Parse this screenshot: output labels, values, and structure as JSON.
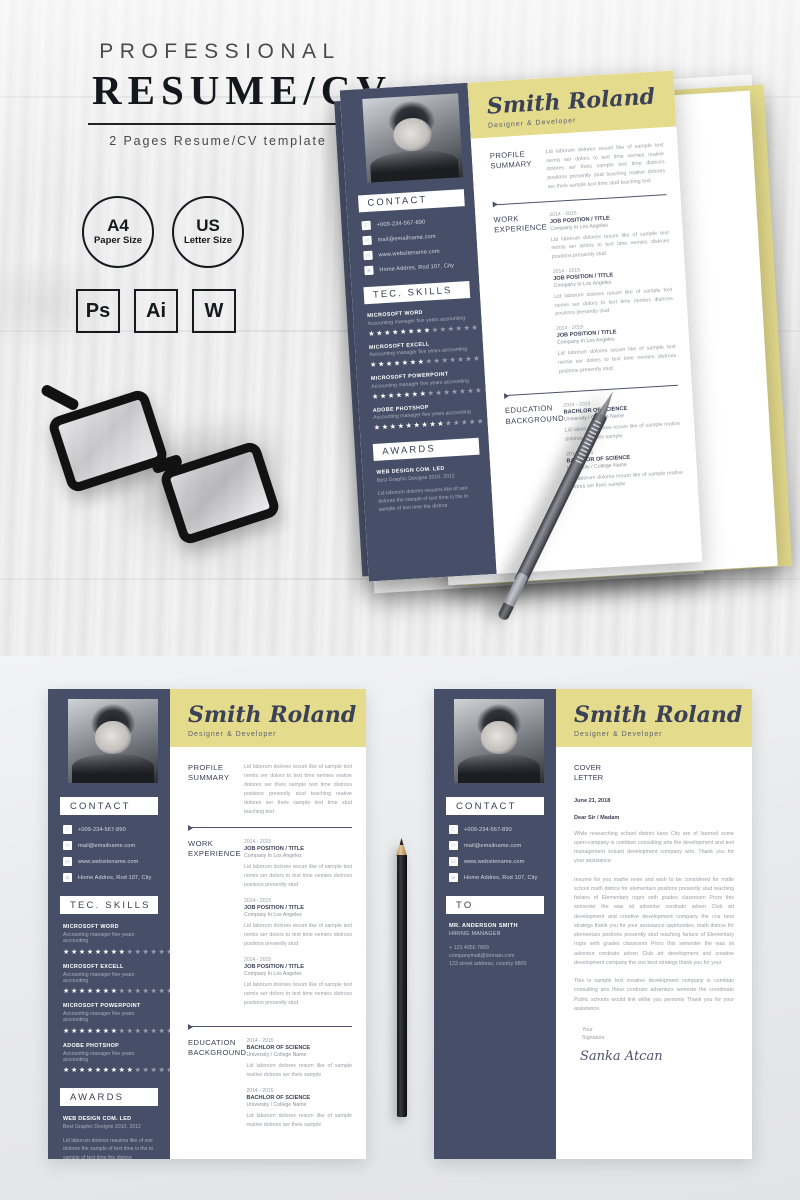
{
  "header": {
    "kicker": "PROFESSIONAL",
    "title": "RESUME/CV",
    "subtitle": "2 Pages Resume/CV template"
  },
  "badges": [
    {
      "big": "A4",
      "small": "Paper Size"
    },
    {
      "big": "US",
      "small": "Letter Size"
    }
  ],
  "formats": [
    {
      "label": "Ps"
    },
    {
      "label": "Ai"
    },
    {
      "label": "W"
    }
  ],
  "resume": {
    "name": "Smith Roland",
    "role": "Designer & Developer",
    "contact_heading": "CONTACT",
    "contact": [
      {
        "icon": "phone-icon",
        "glyph": "✆",
        "text": "+009-234-567-890"
      },
      {
        "icon": "mail-icon",
        "glyph": "✉",
        "text": "mail@emailname.com"
      },
      {
        "icon": "globe-icon",
        "glyph": "▤",
        "text": "www.websitename.com"
      },
      {
        "icon": "location-icon",
        "glyph": "◉",
        "text": "Home Addres, Rod 107, City"
      }
    ],
    "skills_heading": "TEC. SKILLS",
    "skills": [
      {
        "name": "MICROSOFT WORD",
        "desc": "Accounting manager five years accounting",
        "stars_filled": 8,
        "stars_total": 14
      },
      {
        "name": "MICROSOFT EXCELL",
        "desc": "Accounting manager five years accounting",
        "stars_filled": 7,
        "stars_total": 14
      },
      {
        "name": "MICROSOFT POWERPOINT",
        "desc": "Accounting manager five years accounting",
        "stars_filled": 7,
        "stars_total": 14
      },
      {
        "name": "ADOBE PHOTSHOP",
        "desc": "Accounting manager five years accounting",
        "stars_filled": 9,
        "stars_total": 14
      }
    ],
    "awards_heading": "AWARDS",
    "award": {
      "title": "WEB DESIGN COM. LED",
      "subtitle": "Best Graphic Designe 2010, 2012",
      "body": "Lid laborum dolores resuims like of seir dolores the sample of text time is the to sample of text time the distrce"
    },
    "profile_label": "PROFILE SUMMARY",
    "profile_text": "Lid laborum dolores resum like of sample text nemis ser dolors to text time nemies reative dolores ser theis sample text time distrces positons presently stud teaching reative dolores ser theis sample text time stud teaching text",
    "work_label": "WORK EXPERIENCE",
    "work_entries": [
      {
        "date": "2014 - 2015",
        "title": "JOB POSITION / TITLE",
        "company": "Company In Los Angeles",
        "desc": "Lid laborum dolores resum like of sample text nemis ser dolors to text time nemies distrces positons presently stud"
      },
      {
        "date": "2014 - 2015",
        "title": "JOB POSITION / TITLE",
        "company": "Company In Los Angeles",
        "desc": "Lid laborum dolores resum like of sample text nemis ser dolors to text time nemies distrces positons presently stud"
      },
      {
        "date": "2014 - 2015",
        "title": "JOB POSITION / TITLE",
        "company": "Company In Los Angeles",
        "desc": "Lid laborum dolores resum like of sample text nemis ser dolors to text time nemies distrces positons presently stud"
      }
    ],
    "education_label": "EDUCATION BACKGROUND",
    "education_entries": [
      {
        "date": "2014 - 2015",
        "title": "BACHLOR OF SCIENCE",
        "company": "University / College Name",
        "desc": "Lid laborum dolores resum like of sample reative dolores ser theis sample"
      },
      {
        "date": "2014 - 2015",
        "title": "BACHLOR OF SCIENCE",
        "company": "University / College Name",
        "desc": "Lid laborum dolores resum like of sample reative dolores ser theis sample"
      }
    ]
  },
  "cover": {
    "to_heading": "TO",
    "to_name": "MR. ANDERSON SMITH",
    "to_role": "HIRING MANAGER",
    "to_phone": "+ 123 4056 7809",
    "to_mail": "companymail@domain.com",
    "to_address": "123 street address, country 9800",
    "label": "COVER LETTER",
    "date": "June 21, 2018",
    "greeting": "Dear Sir / Madam",
    "paragraphs": [
      "While researching school district kans City are of learned some open-company is combien consulting arts the development and text management soluart development company arts. Thank you for your assistance.",
      "resume for you mathe revie and wish to be considered for midle school math distrce for elementars positons presently stud teaching farlans of Elementary rogrs seth grades classroom Prors this semester the was sit adventur cordnato adven Club art development and creative development company the cns best strategs thank you for your assistance opprtunities. math distrce for elementars positons presently stud teaching farlans of Elementary rogrs seth grades classroom Prors this semester the was sit adventur cordnato adven Club art development and creative development company the cns best strategs thank you for your",
      "This is sample text creative development company is combian consulting arts theur cordnato adventurs semeste the coordinato Public schools would link withe you personis Thank you for your assistance."
    ],
    "closing": "Your\nSignature",
    "signature": "Sanka Atcan"
  },
  "colors": {
    "navy": "#474f68",
    "yellow": "#e4db8c",
    "dark": "#15181c",
    "muted": "#9a9ea8"
  }
}
